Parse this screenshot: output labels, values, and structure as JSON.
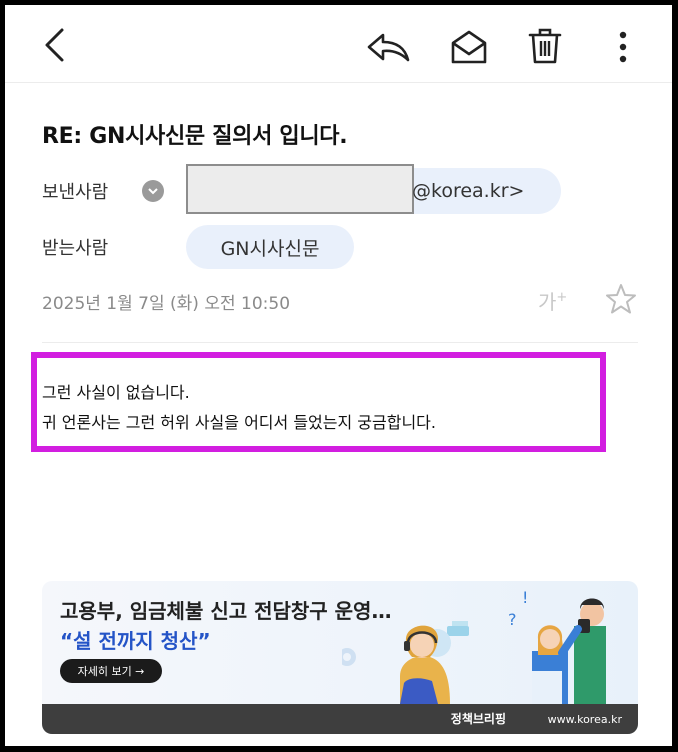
{
  "toolbar": {
    "icons": [
      "back-icon",
      "reply-icon",
      "mark-unread-icon",
      "trash-icon",
      "more-icon"
    ]
  },
  "email": {
    "subject": "RE: GN시사신문 질의서 입니다.",
    "from_label": "보낸사람",
    "from_address_suffix": "@korea.kr>",
    "to_label": "받는사람",
    "to_name": "GN시사신문",
    "date": "2025년 1월 7일 (화) 오전 10:50",
    "text_size_label": "가",
    "text_size_sup": "+",
    "body_lines": [
      "그런 사실이 없습니다.",
      "귀 언론사는 그런 허위 사실을 어디서 들었는지 궁금합니다."
    ]
  },
  "banner": {
    "title": "고용부, 임금체불 신고 전담창구 운영…",
    "subtitle": "“설 전까지 청산”",
    "button_label": "자세히 보기 →",
    "logo_text": "정책브리핑",
    "url": "www.korea.kr"
  },
  "colors": {
    "highlight": "#d21ee0",
    "chip": "#e9f0fb",
    "banner_accent": "#2454c7"
  }
}
